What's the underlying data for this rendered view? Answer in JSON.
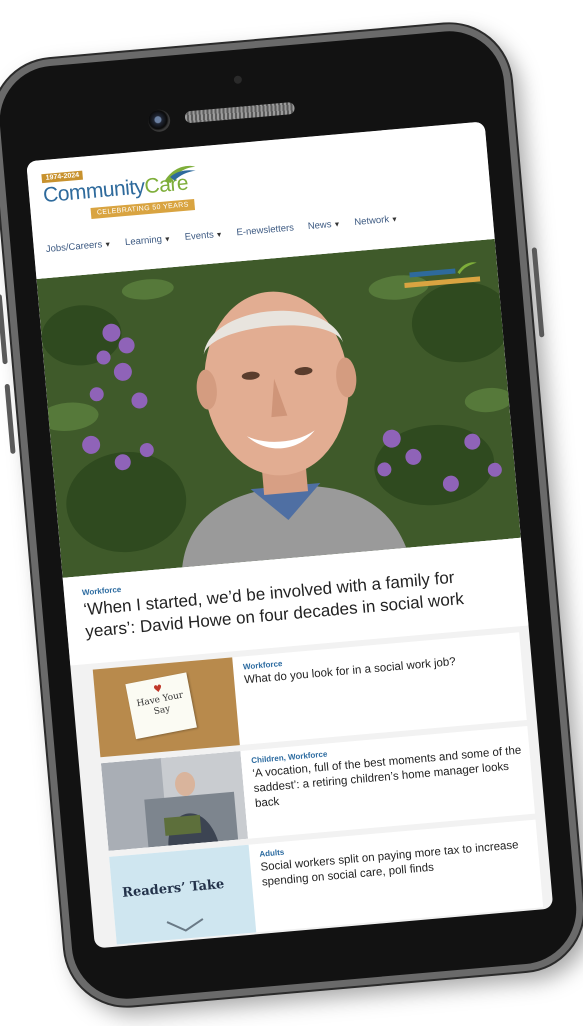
{
  "header": {
    "years_badge": "1974-2024",
    "logo_community": "Community",
    "logo_care": "Care",
    "logo_celebrating": "CELEBRATING 50 YEARS"
  },
  "nav": [
    {
      "label": "Jobs/Careers"
    },
    {
      "label": "Learning"
    },
    {
      "label": "Events"
    },
    {
      "label": "E-newsletters"
    },
    {
      "label": "News"
    },
    {
      "label": "Network"
    }
  ],
  "lead": {
    "category": "Workforce",
    "title": "‘When I started, we’d be involved with a family for years’: David Howe on four decades in social work"
  },
  "stories": [
    {
      "category": "Workforce",
      "title": "What do you look for in a social work job?",
      "thumb_text": "Have Your Say"
    },
    {
      "category": "Children, Workforce",
      "title": "‘A vocation, full of the best moments and some of the saddest’: a retiring children’s home manager looks back"
    },
    {
      "category": "Adults",
      "title": "Social workers split on paying more tax to increase spending on social care, poll finds",
      "thumb_text": "Readers’ Take"
    }
  ],
  "colors": {
    "brand_blue": "#2e6a9c",
    "brand_green": "#7eae3a",
    "gold": "#d9a441",
    "category_blue": "#2c6ba0"
  }
}
